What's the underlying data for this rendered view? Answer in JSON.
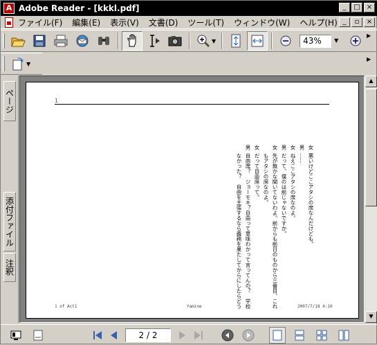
{
  "window": {
    "title": "Adobe Reader - [kkkl.pdf]",
    "caption_buttons": [
      "minimize",
      "maximize",
      "close"
    ],
    "doc_buttons": [
      "minimize",
      "restore",
      "close"
    ]
  },
  "menu": [
    "ファイル(F)",
    "編集(E)",
    "表示(V)",
    "文書(D)",
    "ツール(T)",
    "ウィンドウ(W)",
    "ヘルプ(H)"
  ],
  "toolbar": {
    "zoom_value": "43%",
    "buttons": [
      "open-icon",
      "save-icon",
      "print-icon",
      "email-icon",
      "search-icon",
      "hand-tool-icon",
      "select-text-icon",
      "snapshot-icon",
      "zoom-in-icon",
      "fit-page-icon",
      "fit-width-icon",
      "zoom-out-button",
      "zoom-in-button"
    ]
  },
  "left_tabs": {
    "pages": "ページ",
    "attachments": "添付ファイル",
    "annotations": "注釈"
  },
  "document": {
    "page_number": "1",
    "columns": [
      {
        "speaker": "女",
        "text": "悪いけどここアタシの席なんだけども。"
      },
      {
        "speaker": "男",
        "text": "……"
      },
      {
        "speaker": "女",
        "text": "ねえここアタシの席なのよ。"
      },
      {
        "speaker": "男",
        "text": "だって、僕のは前じゃないですか。"
      },
      {
        "speaker": "女",
        "text": "先が無かな聞いてないわよ。前からも前日のものから三番目、これはいつで"
      },
      {
        "speaker": "",
        "text": "もアタシの席なのよ。"
      },
      {
        "speaker": "女",
        "text": "だって自由席って。"
      },
      {
        "speaker": "男",
        "text": "自由席？　ジョーモキ？自由って意味わかって言ってんの？　学校で習わ"
      },
      {
        "speaker": "",
        "text": "なかった？　自由を主張するなら義務を果たしてからにしたらどう？"
      }
    ],
    "footer_left": "1 of Act1",
    "footer_center": "Yamine",
    "footer_right": "2007/7/18  4:10"
  },
  "status": {
    "page_display": "2 / 2"
  }
}
